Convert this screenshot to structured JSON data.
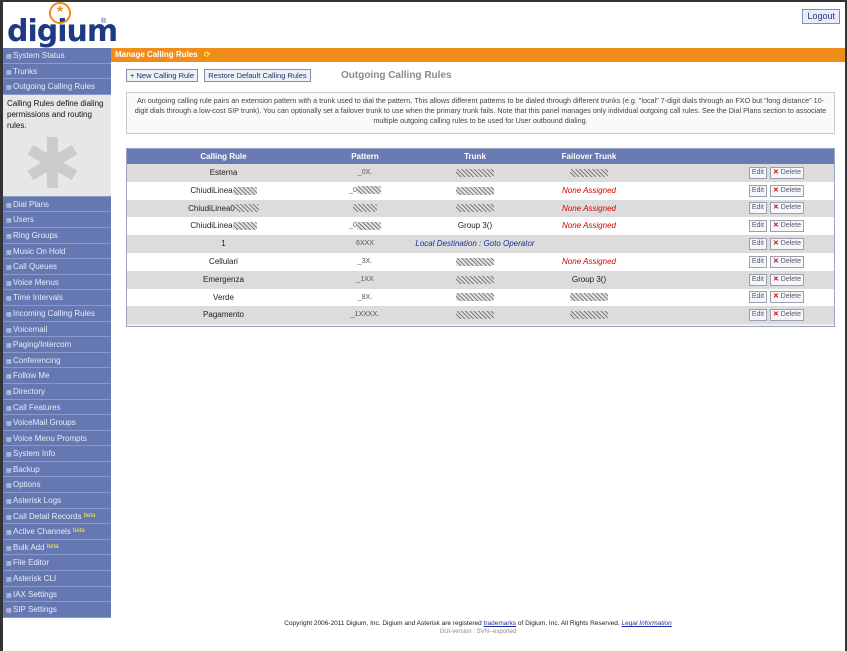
{
  "header": {
    "logo_text": "digium",
    "logo_reg": "®",
    "logout_label": "Logout"
  },
  "sidebar": {
    "top_items": [
      {
        "label": "System Status"
      },
      {
        "label": "Trunks"
      },
      {
        "label": "Outgoing Calling Rules"
      }
    ],
    "description": "Calling Rules define dialing permissions and routing rules.",
    "items": [
      {
        "label": "Dial Plans"
      },
      {
        "label": "Users"
      },
      {
        "label": "Ring Groups"
      },
      {
        "label": "Music On Hold"
      },
      {
        "label": "Call Queues"
      },
      {
        "label": "Voice Menus"
      },
      {
        "label": "Time Intervals"
      },
      {
        "label": "Incoming Calling Rules"
      },
      {
        "label": "Voicemail"
      },
      {
        "label": "Paging/Intercom"
      },
      {
        "label": "Conferencing"
      },
      {
        "label": "Follow Me"
      },
      {
        "label": "Directory"
      },
      {
        "label": "Call Features"
      },
      {
        "label": "VoiceMail Groups"
      },
      {
        "label": "Voice Menu Prompts"
      },
      {
        "label": "System Info"
      },
      {
        "label": "Backup"
      },
      {
        "label": "Options"
      },
      {
        "label": "Asterisk Logs"
      },
      {
        "label": "Call Detail Records",
        "beta": "beta"
      },
      {
        "label": "Active Channels",
        "beta": "beta"
      },
      {
        "label": "Bulk Add",
        "beta": "beta"
      },
      {
        "label": "File Editor"
      },
      {
        "label": "Asterisk CLI"
      },
      {
        "label": "IAX Settings"
      },
      {
        "label": "SIP Settings"
      }
    ]
  },
  "main": {
    "title": "Manage Calling Rules",
    "reload_glyph": "⟳",
    "new_rule_label": "New Calling Rule",
    "restore_label": "Restore Default Calling Rules",
    "heading": "Outgoing Calling Rules",
    "description": "An outgoing calling rule pairs an extension pattern with a trunk used to dial the pattern. This allows different patterns to be dialed through different trunks (e.g. \"local\" 7-digit dials through an FXO but \"long distance\" 10-digit dials through a low-cost SIP trunk). You can optionally set a failover trunk to use when the primary trunk fails. Note that this panel manages only individual outgoing call rules. See the Dial Plans section to associate multiple outgoing calling rules to be used for User outbound dialing.",
    "columns": [
      "Calling Rule",
      "Pattern",
      "Trunk",
      "Failover Trunk"
    ],
    "edit_label": "Edit",
    "delete_label": "Delete",
    "rows": [
      {
        "rule": "Esterna",
        "pattern": "_0X.",
        "trunk": "",
        "failover": ""
      },
      {
        "rule": "ChiudiLinea",
        "pattern": "_0",
        "trunk": "",
        "failover": "None Assigned"
      },
      {
        "rule": "ChiudiLinea0",
        "pattern": "",
        "trunk": "",
        "failover": "None Assigned"
      },
      {
        "rule": "ChiudiLinea",
        "pattern": "_0",
        "trunk": "Group 3()",
        "failover": "None Assigned"
      },
      {
        "rule": "1",
        "pattern": "6XXX",
        "trunk": "Local Destination : Goto Operator",
        "failover": ""
      },
      {
        "rule": "Cellulari",
        "pattern": "_3X.",
        "trunk": "",
        "failover": "None Assigned"
      },
      {
        "rule": "Emergenza",
        "pattern": "_1XX",
        "trunk": "",
        "failover": "Group 3()"
      },
      {
        "rule": "Verde",
        "pattern": "_8X.",
        "trunk": "",
        "failover": ""
      },
      {
        "rule": "Pagamento",
        "pattern": "_1XXXX.",
        "trunk": "",
        "failover": ""
      }
    ]
  },
  "footer": {
    "copyright_pre": "Copyright 2006-2011 Digium, Inc. Digium and Asterisk are registered",
    "trademarks_link": "trademarks",
    "copyright_post": "of Digium, Inc. All Rights Reserved.",
    "legal_link": "Legal Information",
    "version": "GUI-version : SVN--exported"
  }
}
